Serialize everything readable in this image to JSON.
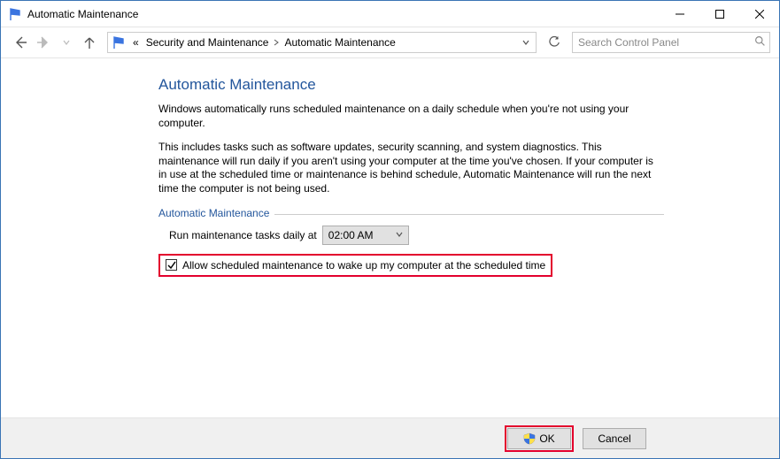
{
  "window": {
    "title": "Automatic Maintenance"
  },
  "breadcrumb": {
    "prefix": "«",
    "items": [
      "Security and Maintenance",
      "Automatic Maintenance"
    ]
  },
  "search": {
    "placeholder": "Search Control Panel"
  },
  "page": {
    "heading": "Automatic Maintenance",
    "paragraph1": "Windows automatically runs scheduled maintenance on a daily schedule when you're not using your computer.",
    "paragraph2": "This includes tasks such as software updates, security scanning, and system diagnostics. This maintenance will run daily if you aren't using your computer at the time you've chosen. If your computer is in use at the scheduled time or maintenance is behind schedule, Automatic Maintenance will run the next time the computer is not being used."
  },
  "section": {
    "legend": "Automatic Maintenance",
    "run_label": "Run maintenance tasks daily at",
    "time_value": "02:00 AM",
    "allow_label": "Allow scheduled maintenance to wake up my computer at the scheduled time",
    "allow_checked": true
  },
  "buttons": {
    "ok": "OK",
    "cancel": "Cancel"
  }
}
